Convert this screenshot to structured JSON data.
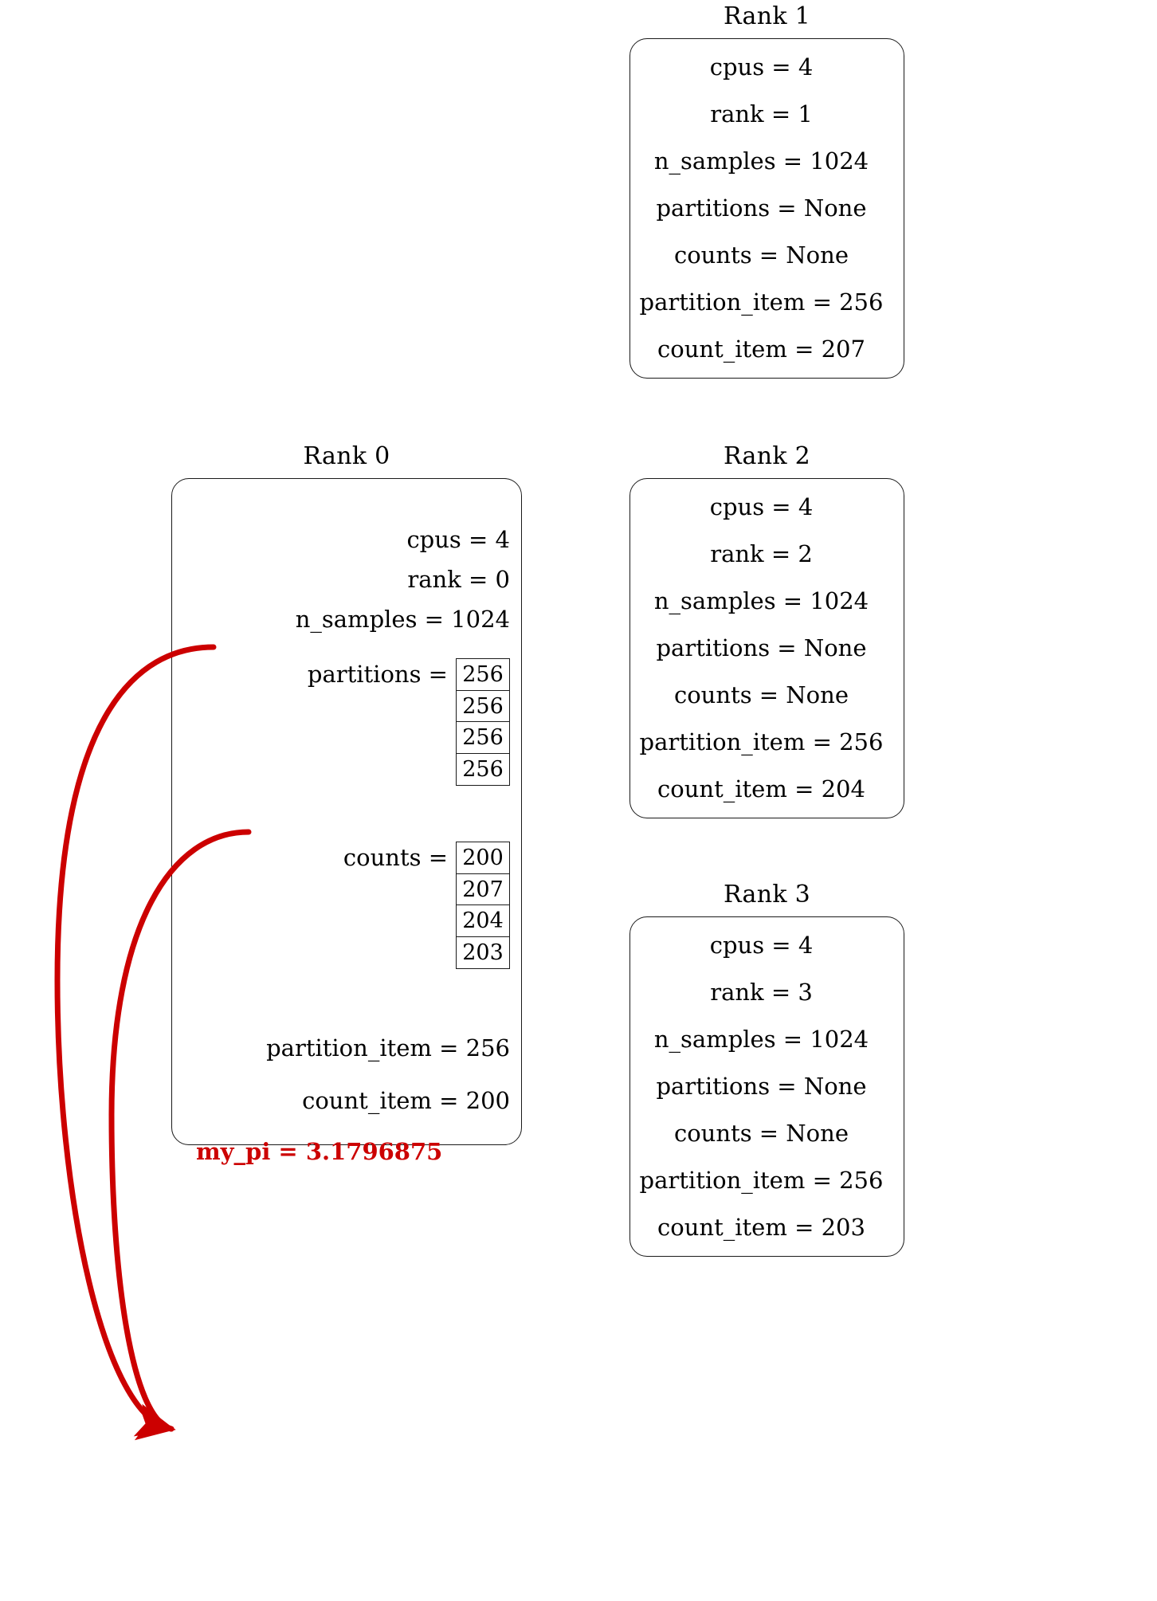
{
  "diagram": {
    "highlight_color": "#cc0000",
    "box_border_color": "#1a1a1a"
  },
  "rank0": {
    "title": "Rank 0",
    "fields": {
      "cpus": "cpus = 4",
      "rank": "rank = 0",
      "n_samples": "n_samples = 1024",
      "partitions_label": "partitions =",
      "counts_label": "counts =",
      "partition_item": "partition_item = 256",
      "count_item": "count_item = 200",
      "my_pi": "my_pi = 3.1796875"
    },
    "partitions": [
      "256",
      "256",
      "256",
      "256"
    ],
    "counts": [
      "200",
      "207",
      "204",
      "203"
    ]
  },
  "rank1": {
    "title": "Rank 1",
    "fields": [
      "cpus = 4",
      "rank = 1",
      "n_samples = 1024",
      "partitions = None",
      "counts = None",
      "partition_item = 256",
      "count_item = 207"
    ]
  },
  "rank2": {
    "title": "Rank 2",
    "fields": [
      "cpus = 4",
      "rank = 2",
      "n_samples = 1024",
      "partitions = None",
      "counts = None",
      "partition_item = 256",
      "count_item = 204"
    ]
  },
  "rank3": {
    "title": "Rank 3",
    "fields": [
      "cpus = 4",
      "rank = 3",
      "n_samples = 1024",
      "partitions = None",
      "counts = None",
      "partition_item = 256",
      "count_item = 203"
    ]
  }
}
